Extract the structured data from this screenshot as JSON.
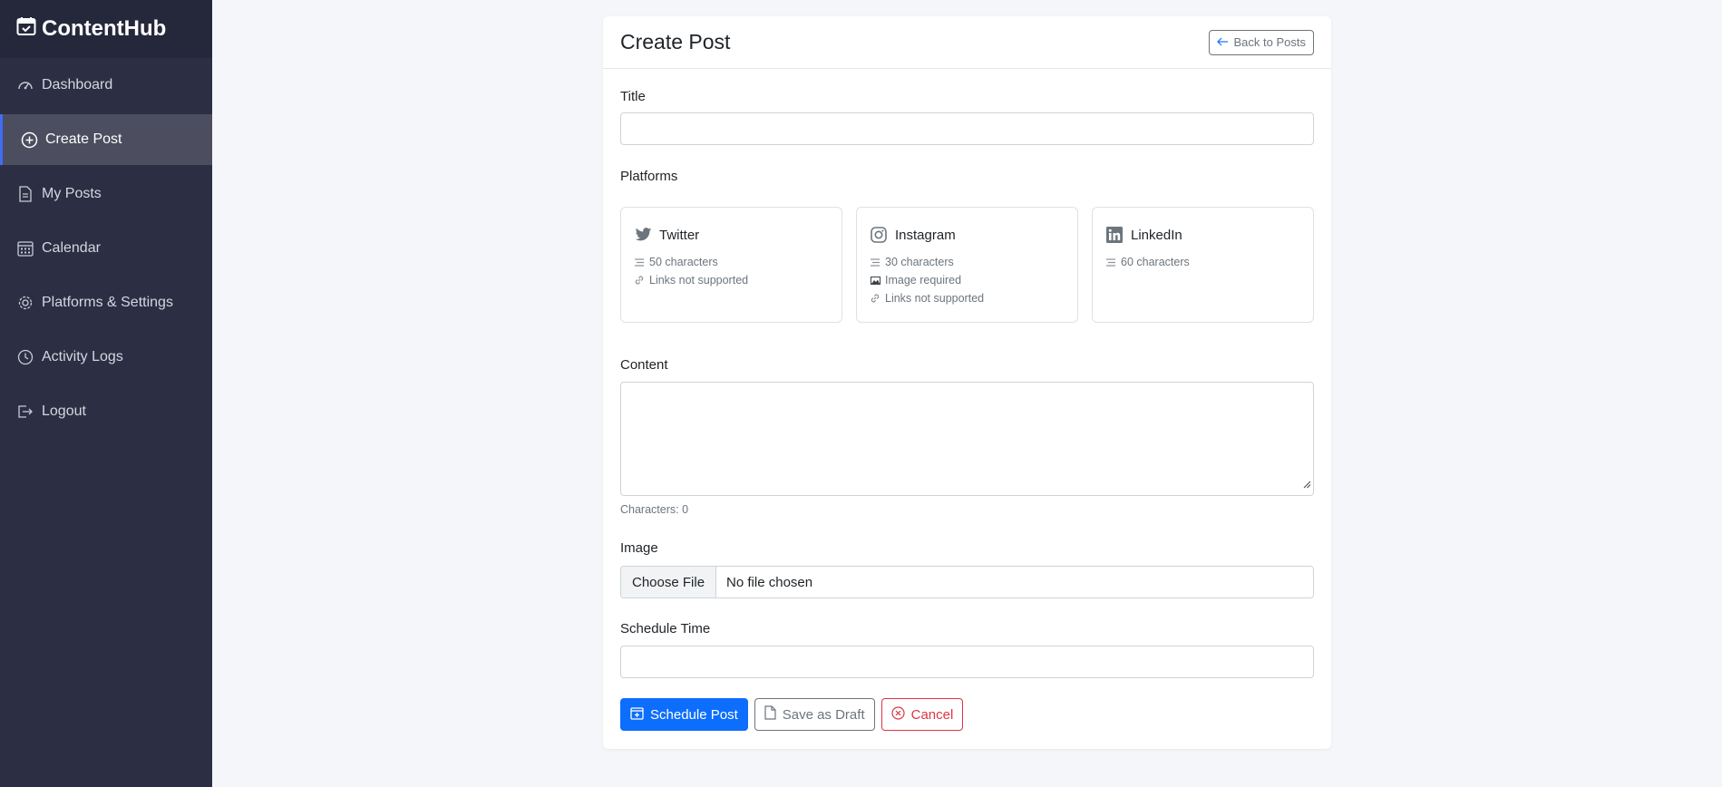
{
  "app": {
    "name": "ContentHub"
  },
  "sidebar": {
    "items": [
      {
        "label": "Dashboard",
        "icon": "speedometer-icon"
      },
      {
        "label": "Create Post",
        "icon": "plus-circle-icon",
        "active": true
      },
      {
        "label": "My Posts",
        "icon": "document-icon"
      },
      {
        "label": "Calendar",
        "icon": "calendar-icon"
      },
      {
        "label": "Platforms & Settings",
        "icon": "gear-icon"
      },
      {
        "label": "Activity Logs",
        "icon": "clock-icon"
      },
      {
        "label": "Logout",
        "icon": "logout-icon"
      }
    ]
  },
  "page": {
    "title": "Create Post",
    "back_label": "Back to Posts"
  },
  "form": {
    "title_label": "Title",
    "title_value": "",
    "platforms_label": "Platforms",
    "platforms": [
      {
        "name": "Twitter",
        "icon": "twitter-icon",
        "rules": [
          "50 characters",
          "Links not supported"
        ]
      },
      {
        "name": "Instagram",
        "icon": "instagram-icon",
        "rules": [
          "30 characters",
          "Image required",
          "Links not supported"
        ]
      },
      {
        "name": "LinkedIn",
        "icon": "linkedin-icon",
        "rules": [
          "60 characters"
        ]
      }
    ],
    "content_label": "Content",
    "content_value": "",
    "char_count": "Characters: 0",
    "image_label": "Image",
    "file_button": "Choose File",
    "file_status": "No file chosen",
    "schedule_label": "Schedule Time",
    "schedule_value": ""
  },
  "actions": {
    "schedule": "Schedule Post",
    "draft": "Save as Draft",
    "cancel": "Cancel"
  },
  "colors": {
    "sidebar_bg": "#2c2f44",
    "brand_bg": "#25283a",
    "active_accent": "#3f6ef2",
    "primary": "#0d6efd",
    "danger": "#dc3545",
    "secondary": "#6c757d"
  }
}
